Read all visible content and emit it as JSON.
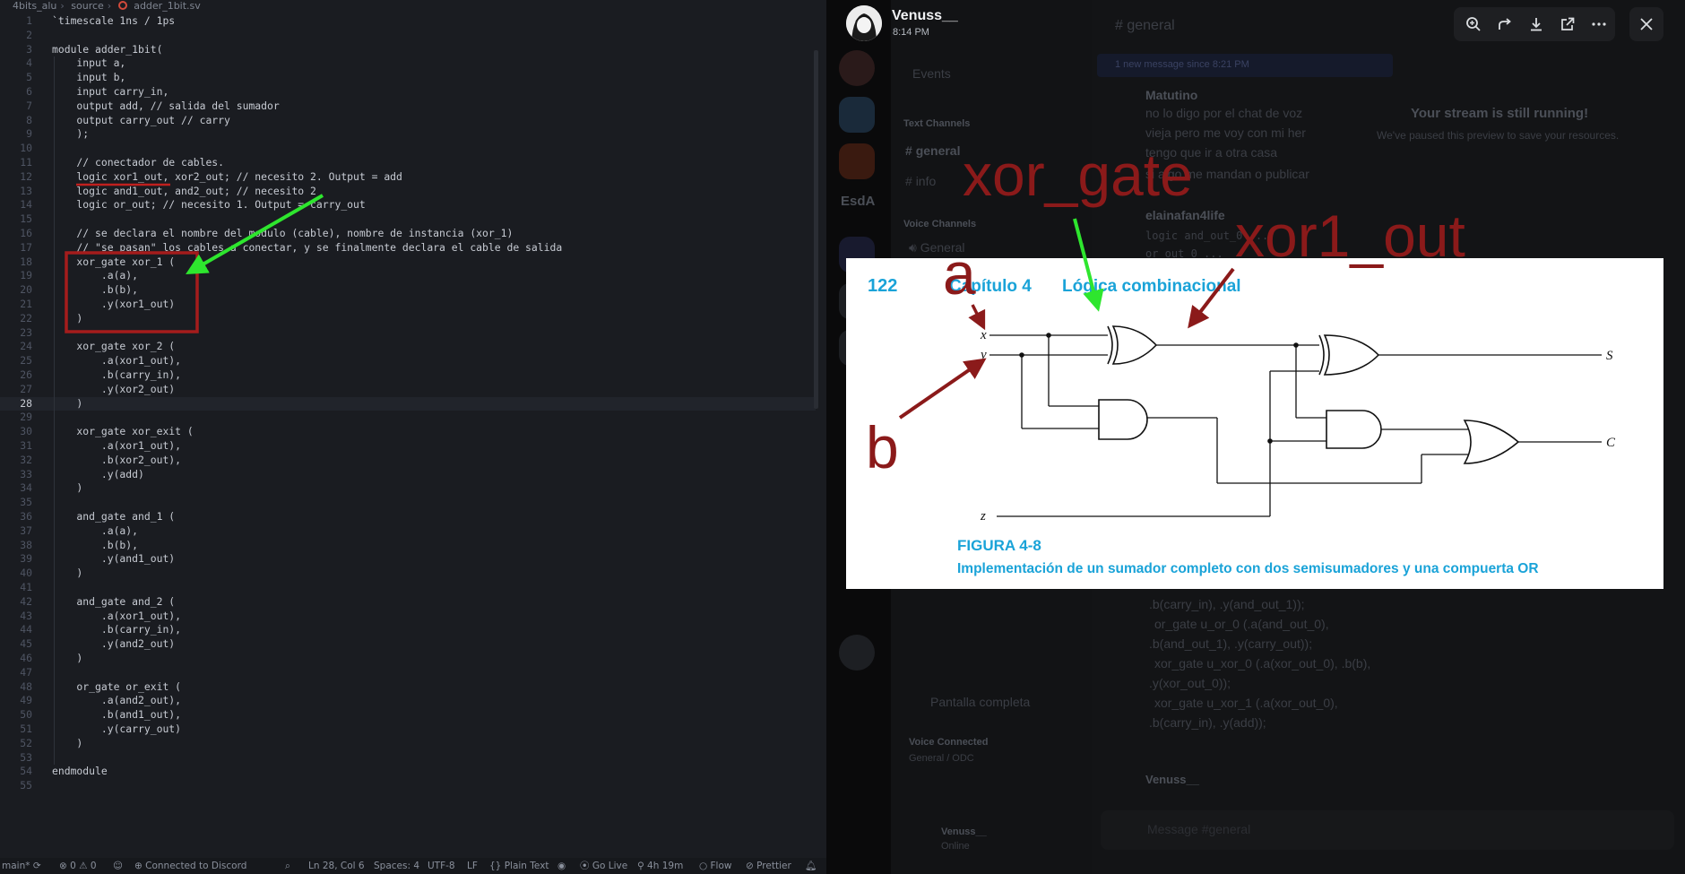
{
  "editor": {
    "breadcrumb": [
      "4bits_alu",
      "source",
      "adder_1bit.sv"
    ],
    "active_line": 28,
    "lines": [
      "`timescale 1ns / 1ps",
      "",
      "module adder_1bit(",
      "    input a,",
      "    input b,",
      "    input carry_in,",
      "    output add, // salida del sumador",
      "    output carry_out // carry",
      "    );",
      "",
      "    // conectador de cables.",
      "    logic xor1_out, xor2_out; // necesito 2. Output = add",
      "    logic and1_out, and2_out; // necesito 2",
      "    logic or_out; // necesito 1. Output = carry_out",
      "",
      "    // se declara el nombre del modulo (cable), nombre de instancia (xor_1)",
      "    // \"se pasan\" los cables a conectar, y se finalmente declara el cable de salida",
      "    xor_gate xor_1 (",
      "        .a(a),",
      "        .b(b),",
      "        .y(xor1_out)",
      "    )",
      "",
      "    xor_gate xor_2 (",
      "        .a(xor1_out),",
      "        .b(carry_in),",
      "        .y(xor2_out)",
      "    )",
      "",
      "    xor_gate xor_exit (",
      "        .a(xor1_out),",
      "        .b(xor2_out),",
      "        .y(add)",
      "    )",
      "",
      "    and_gate and_1 (",
      "        .a(a),",
      "        .b(b),",
      "        .y(and1_out)",
      "    )",
      "",
      "    and_gate and_2 (",
      "        .a(xor1_out),",
      "        .b(carry_in),",
      "        .y(and2_out)",
      "    )",
      "",
      "    or_gate or_exit (",
      "        .a(and2_out),",
      "        .b(and1_out),",
      "        .y(carry_out)",
      "    )",
      "",
      "endmodule",
      ""
    ]
  },
  "statusbar": {
    "branch": "main*",
    "problems": "⊗ 0 ⚠ 0",
    "discord": "Connected to Discord",
    "position": "Ln 28, Col 6",
    "spaces": "Spaces: 4",
    "encoding": "UTF-8",
    "eol": "LF",
    "language": "{} Plain Text",
    "golive": "Go Live",
    "time": "4h 19m",
    "flow": "Flow",
    "prettier": "Prettier"
  },
  "viewer": {
    "uploader": "Venuss__",
    "time": "8:14 PM",
    "icons": [
      "zoom-in-icon",
      "forward-icon",
      "download-icon",
      "open-external-icon",
      "more-icon"
    ],
    "close_icon": "close-icon"
  },
  "figure": {
    "page_number": "122",
    "chapter": "Capítulo 4",
    "chapter_title": "Lógica combinacional",
    "inputs": [
      "x",
      "y",
      "z"
    ],
    "outputs": [
      "S",
      "C"
    ],
    "caption_label": "FIGURA 4-8",
    "caption_text": "Implementación de un sumador completo con dos semisumadores y una compuerta OR",
    "accent_color": "#1aa3d8"
  },
  "annotations": {
    "xor_gate": "xor_gate",
    "xor1_out": "xor1_out",
    "a": "a",
    "b": "b",
    "red": "#8b1a1a",
    "green": "#2ee62e"
  },
  "discord_bg": {
    "channel_general": "general",
    "events": "Events",
    "new_messages": "1 new message since 8:21 PM",
    "text_channels": "Text Channels",
    "ch1": "general",
    "ch2": "info",
    "voice_channels": "Voice Channels",
    "voice_general": "General",
    "server_short": "EsdA",
    "msg_author1": "Matutino",
    "msg1": "no lo digo por el chat de voz",
    "msg1b": "vieja pero me voy con mi her",
    "msg1c": "tengo que ir a otra casa",
    "msg1d": "si algo me mandan o publicar",
    "msg_author2": "elainafan4life",
    "msg2": "logic and_out_0 ...",
    "msg2b": "or_out_0 ...",
    "stream_title": "Your stream is still running!",
    "stream_sub": "We've paused this preview to save your resources.",
    "code1": ".b(carry_in), .y(and_out_1));",
    "code2": "or_gate u_or_0 (.a(and_out_0),",
    "code3": ".b(and_out_1), .y(carry_out));",
    "code4": "xor_gate u_xor_0 (.a(xor_out_0), .b(b),",
    "code5": ".y(xor_out_0));",
    "code6": "xor_gate u_xor_1 (.a(xor_out_0),",
    "code7": ".b(carry_in), .y(add));",
    "fullscreen": "Pantalla completa",
    "voice_connected": "Voice Connected",
    "voice_sub": "General / ODC",
    "msg_author3": "Venuss__",
    "user_name": "Venuss__",
    "user_status": "Online",
    "message_placeholder": "Message #general"
  }
}
